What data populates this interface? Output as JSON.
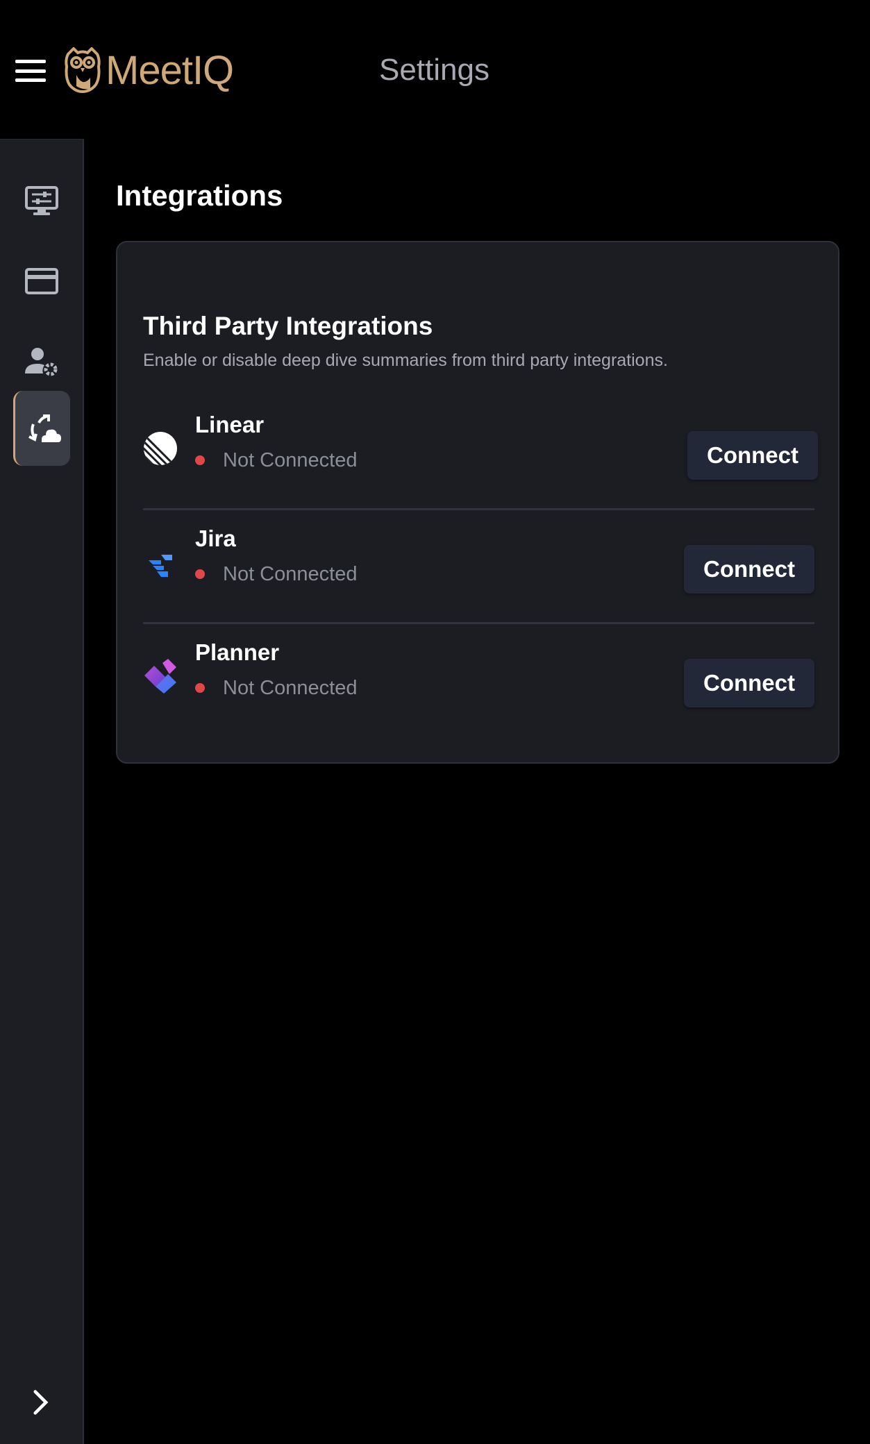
{
  "header": {
    "brand": "MeetIQ",
    "page_title": "Settings",
    "brand_color": "#cfa878"
  },
  "sidebar": {
    "items": [
      {
        "name": "display-settings",
        "icon": "monitor-sliders-icon",
        "active": false
      },
      {
        "name": "billing",
        "icon": "credit-card-icon",
        "active": false
      },
      {
        "name": "account",
        "icon": "user-gear-icon",
        "active": false
      },
      {
        "name": "integrations",
        "icon": "sync-cloud-icon",
        "active": true
      }
    ],
    "expand_icon": "chevron-right-icon"
  },
  "main": {
    "heading": "Integrations",
    "card": {
      "title": "Third Party Integrations",
      "subtitle": "Enable or disable deep dive summaries from third party integrations.",
      "integrations": [
        {
          "name": "Linear",
          "status": "Not Connected",
          "action": "Connect",
          "icon": "linear-logo-icon"
        },
        {
          "name": "Jira",
          "status": "Not Connected",
          "action": "Connect",
          "icon": "jira-logo-icon"
        },
        {
          "name": "Planner",
          "status": "Not Connected",
          "action": "Connect",
          "icon": "planner-logo-icon"
        }
      ]
    }
  },
  "colors": {
    "status_disconnected": "#e04848",
    "accent": "#cfa878"
  }
}
